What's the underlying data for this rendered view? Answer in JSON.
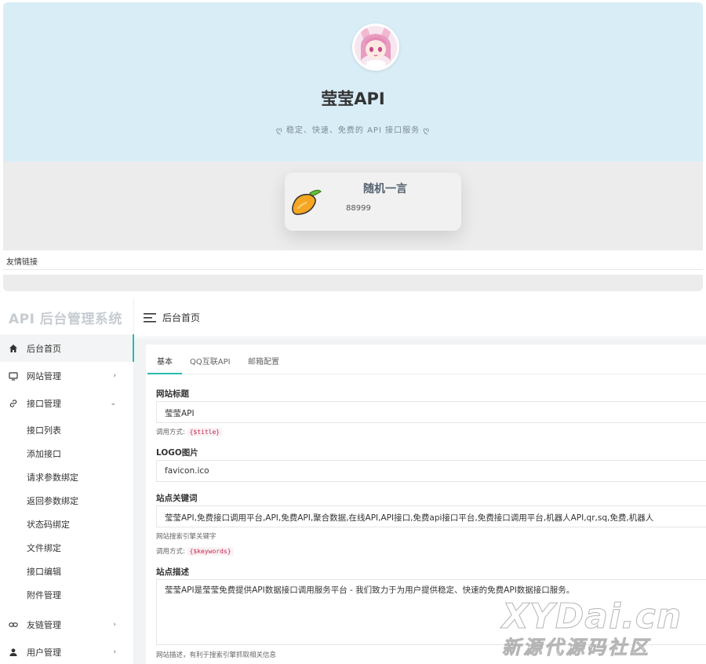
{
  "front": {
    "site_title": "莹莹API",
    "slogan": "稳定、快速、免费的 API 接口服务",
    "quote_title": "随机一言",
    "quote_text": "88999",
    "friend_links_label": "友情链接"
  },
  "admin": {
    "brand": "API 后台管理系统",
    "breadcrumb": "后台首页",
    "nav": [
      {
        "label": "后台首页",
        "icon": "home-icon",
        "active": true
      },
      {
        "label": "网站管理",
        "icon": "monitor-icon",
        "arrow": "›"
      },
      {
        "label": "接口管理",
        "icon": "link-icon",
        "arrow": "⌄"
      },
      {
        "label": "友链管理",
        "icon": "chain-icon",
        "arrow": "›"
      },
      {
        "label": "用户管理",
        "icon": "user-icon",
        "arrow": "›"
      }
    ],
    "sub_nav": [
      "接口列表",
      "添加接口",
      "请求参数绑定",
      "返回参数绑定",
      "状态码绑定",
      "文件绑定",
      "接口编辑",
      "附件管理"
    ],
    "tabs": [
      "基本",
      "QQ互联API",
      "邮箱配置"
    ],
    "form": {
      "title_label": "网站标题",
      "title_value": "莹莹API",
      "title_help_prefix": "调用方式:",
      "title_code": "{$title}",
      "logo_label": "LOGO图片",
      "logo_value": "favicon.ico",
      "keywords_label": "站点关键词",
      "keywords_value": "莹莹API,免费接口调用平台,API,免费API,聚合数据,在线API,API接口,免费api接口平台,免费接口调用平台,机器人API,qr,sq,免费,机器人",
      "keywords_help": "网站搜索引擎关键字",
      "keywords_help_prefix": "调用方式:",
      "keywords_code": "{$keywords}",
      "desc_label": "站点描述",
      "desc_value": "莹莹API是莹莹免费提供API数据接口调用服务平台 - 我们致力于为用户提供稳定、快速的免费API数据接口服务。",
      "desc_help": "网站描述，有利于搜索引擎抓取相关信息"
    }
  },
  "watermark": {
    "line1": "XYDai.cn",
    "line2": "新源代源码社区"
  },
  "colors": {
    "hero_bg": "#d9edf7",
    "accent": "#2bbbad",
    "code_red": "#c7254e"
  }
}
